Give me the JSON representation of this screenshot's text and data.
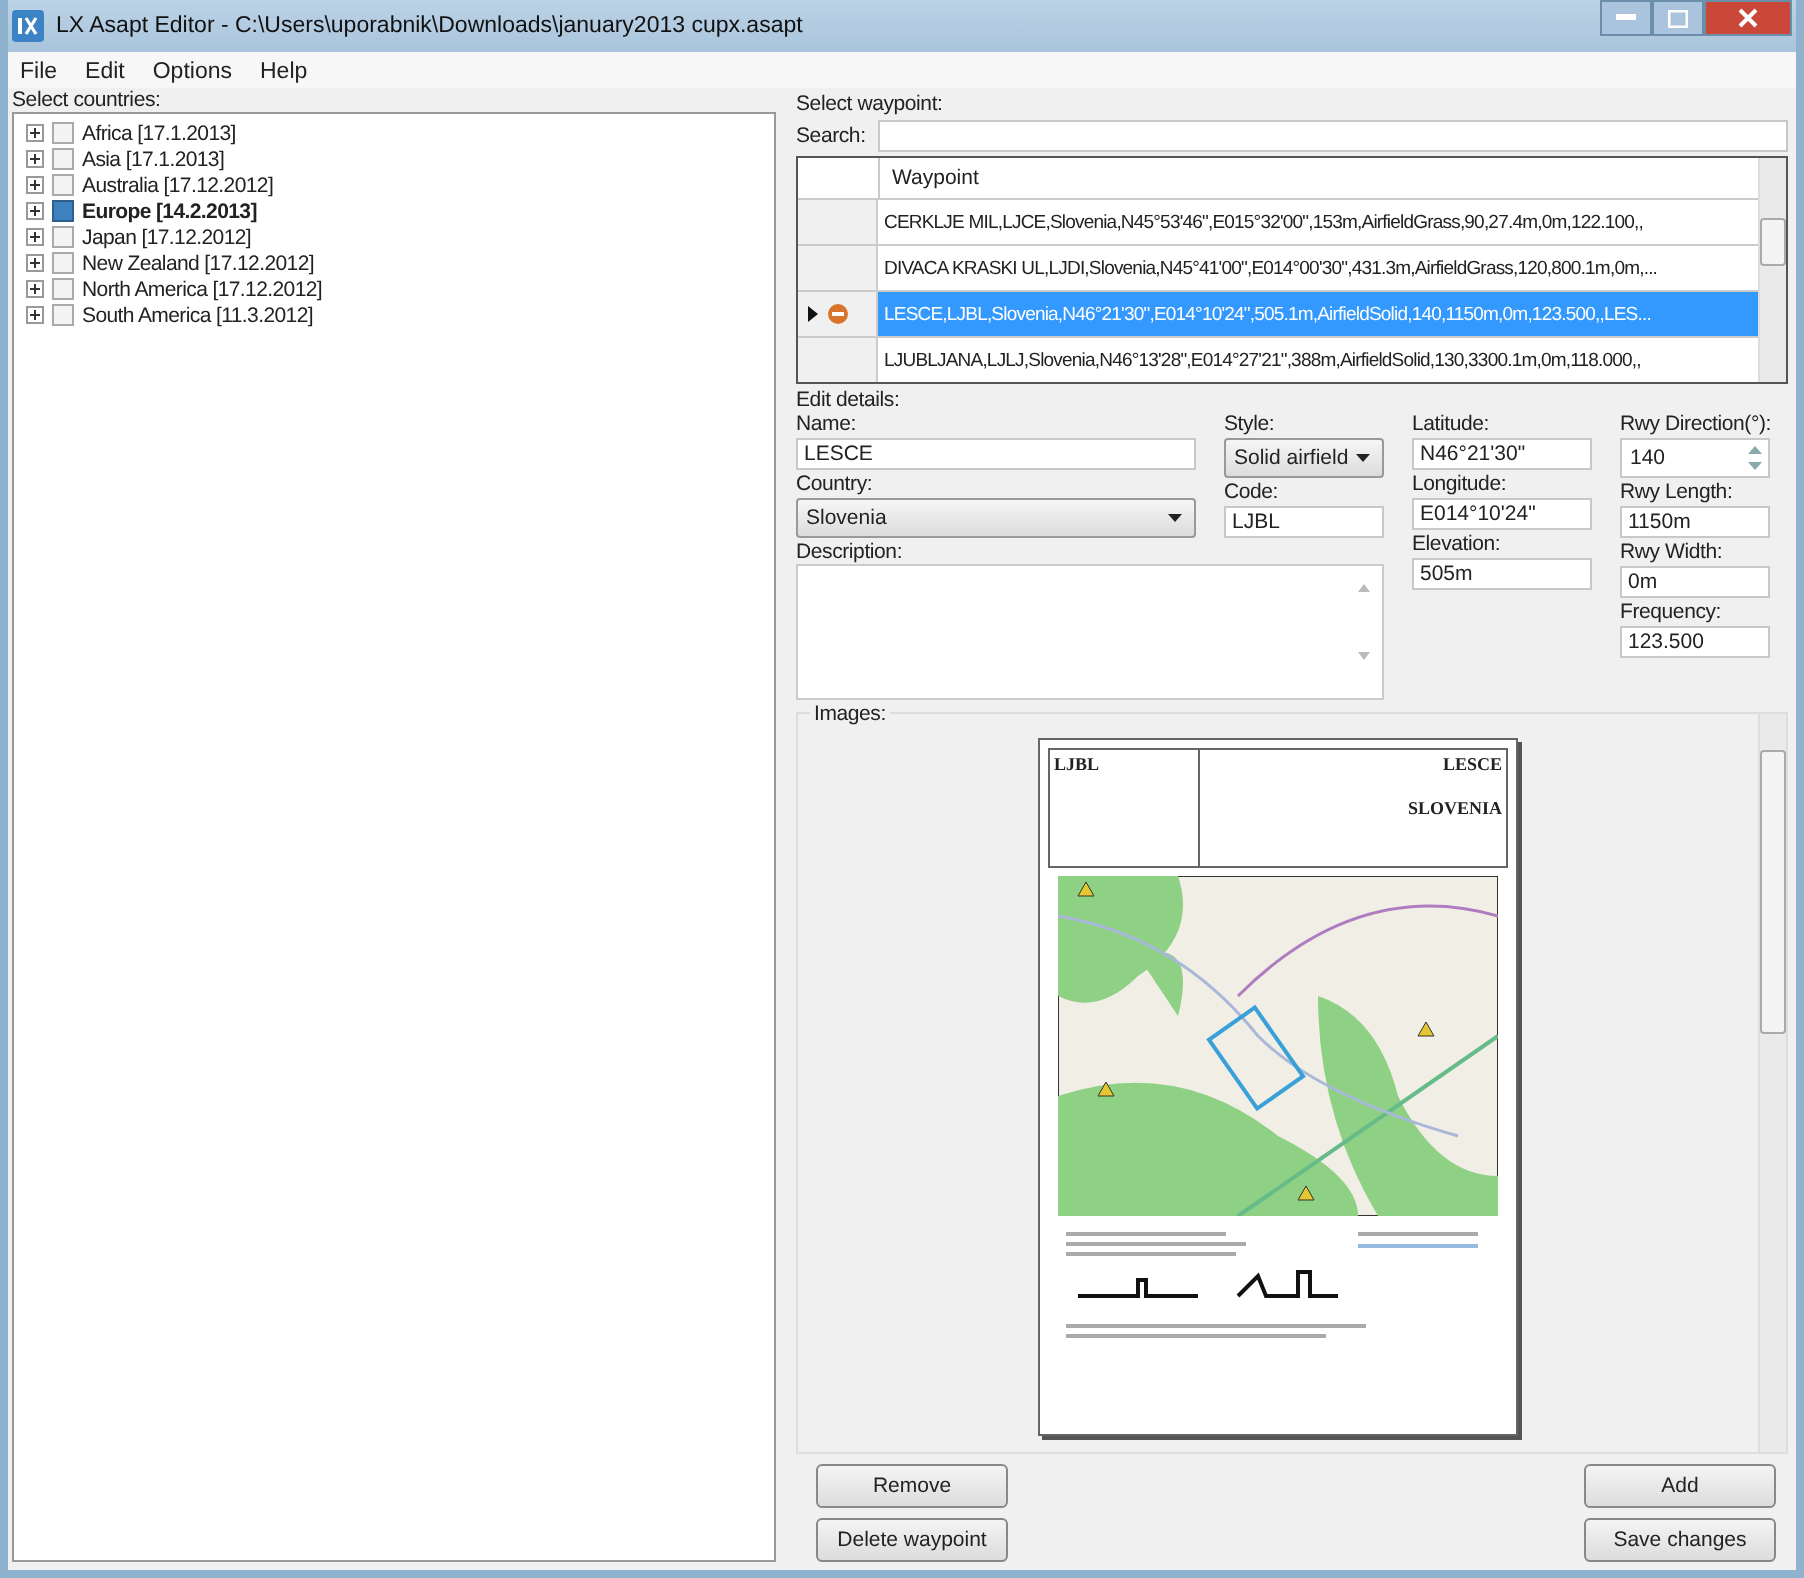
{
  "window": {
    "title": "LX Asapt Editor - C:\\Users\\uporabnik\\Downloads\\january2013 cupx.asapt"
  },
  "menu": [
    "File",
    "Edit",
    "Options",
    "Help"
  ],
  "countries": {
    "label": "Select countries:",
    "items": [
      {
        "label": "Africa [17.1.2013]",
        "checked": false
      },
      {
        "label": "Asia [17.1.2013]",
        "checked": false
      },
      {
        "label": "Australia [17.12.2012]",
        "checked": false
      },
      {
        "label": "Europe [14.2.2013]",
        "checked": true
      },
      {
        "label": "Japan [17.12.2012]",
        "checked": false
      },
      {
        "label": "New Zealand [17.12.2012]",
        "checked": false
      },
      {
        "label": "North America [17.12.2012]",
        "checked": false
      },
      {
        "label": "South America [11.3.2012]",
        "checked": false
      }
    ]
  },
  "waypoints": {
    "label": "Select waypoint:",
    "search_label": "Search:",
    "column": "Waypoint",
    "rows": [
      {
        "text": "CERKLJE MIL,LJCE,Slovenia,N45°53'46\",E015°32'00\",153m,AirfieldGrass,90,27.4m,0m,122.100,,",
        "selected": false
      },
      {
        "text": "DIVACA KRASKI UL,LJDI,Slovenia,N45°41'00\",E014°00'30\",431.3m,AirfieldGrass,120,800.1m,0m,...",
        "selected": false
      },
      {
        "text": "LESCE,LJBL,Slovenia,N46°21'30\",E014°10'24\",505.1m,AirfieldSolid,140,1150m,0m,123.500,,LES...",
        "selected": true
      },
      {
        "text": "LJUBLJANA,LJLJ,Slovenia,N46°13'28\",E014°27'21\",388m,AirfieldSolid,130,3300.1m,0m,118.000,,",
        "selected": false
      }
    ]
  },
  "details": {
    "label": "Edit details:",
    "name": {
      "label": "Name:",
      "value": "LESCE"
    },
    "country": {
      "label": "Country:",
      "value": "Slovenia"
    },
    "description": {
      "label": "Description:"
    },
    "style": {
      "label": "Style:",
      "value": "Solid airfield"
    },
    "code": {
      "label": "Code:",
      "value": "LJBL"
    },
    "latitude": {
      "label": "Latitude:",
      "value": "N46°21'30\""
    },
    "longitude": {
      "label": "Longitude:",
      "value": "E014°10'24\""
    },
    "elevation": {
      "label": "Elevation:",
      "value": "505m"
    },
    "rwy_direction": {
      "label": "Rwy Direction(°):",
      "value": "140"
    },
    "rwy_length": {
      "label": "Rwy Length:",
      "value": "1150m"
    },
    "rwy_width": {
      "label": "Rwy Width:",
      "value": "0m"
    },
    "frequency": {
      "label": "Frequency:",
      "value": "123.500"
    }
  },
  "images": {
    "label": "Images:",
    "document": {
      "code": "LJBL",
      "name": "LESCE",
      "country": "SLOVENIA"
    }
  },
  "buttons": {
    "remove": "Remove",
    "add": "Add",
    "delete": "Delete waypoint",
    "save": "Save changes"
  }
}
